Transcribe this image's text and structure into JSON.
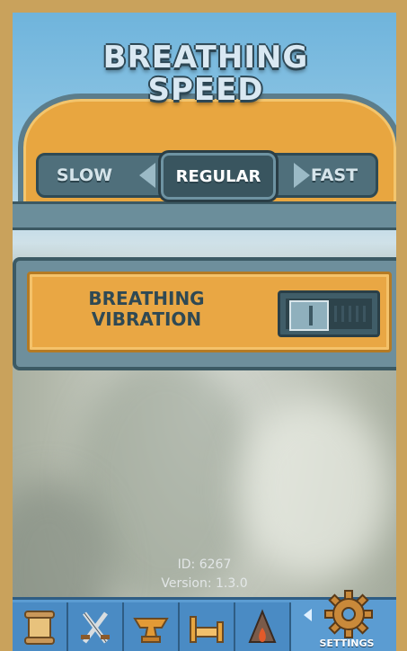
{
  "breathing_speed": {
    "title_line1": "BREATHING",
    "title_line2": "SPEED",
    "options": {
      "slow": "SLOW",
      "regular": "REGULAR",
      "fast": "FAST"
    },
    "selected": "REGULAR"
  },
  "breathing_vibration": {
    "label_line1": "BREATHING",
    "label_line2": "VIBRATION",
    "toggle_state": "off"
  },
  "info": {
    "id_text": "ID: 6267",
    "version_text": "Version: 1.3.0"
  },
  "nav": {
    "items": [
      {
        "icon": "scroll-icon"
      },
      {
        "icon": "crossed-swords-icon"
      },
      {
        "icon": "anvil-icon"
      },
      {
        "icon": "bed-icon"
      },
      {
        "icon": "campfire-icon"
      }
    ],
    "settings_label": "SETTINGS",
    "settings_icon": "gear-icon"
  },
  "colors": {
    "panel_orange": "#e9a744",
    "frame_steel": "#5c7d8b",
    "nav_blue": "#5b9cd2",
    "outer_frame": "#c9a25c"
  }
}
